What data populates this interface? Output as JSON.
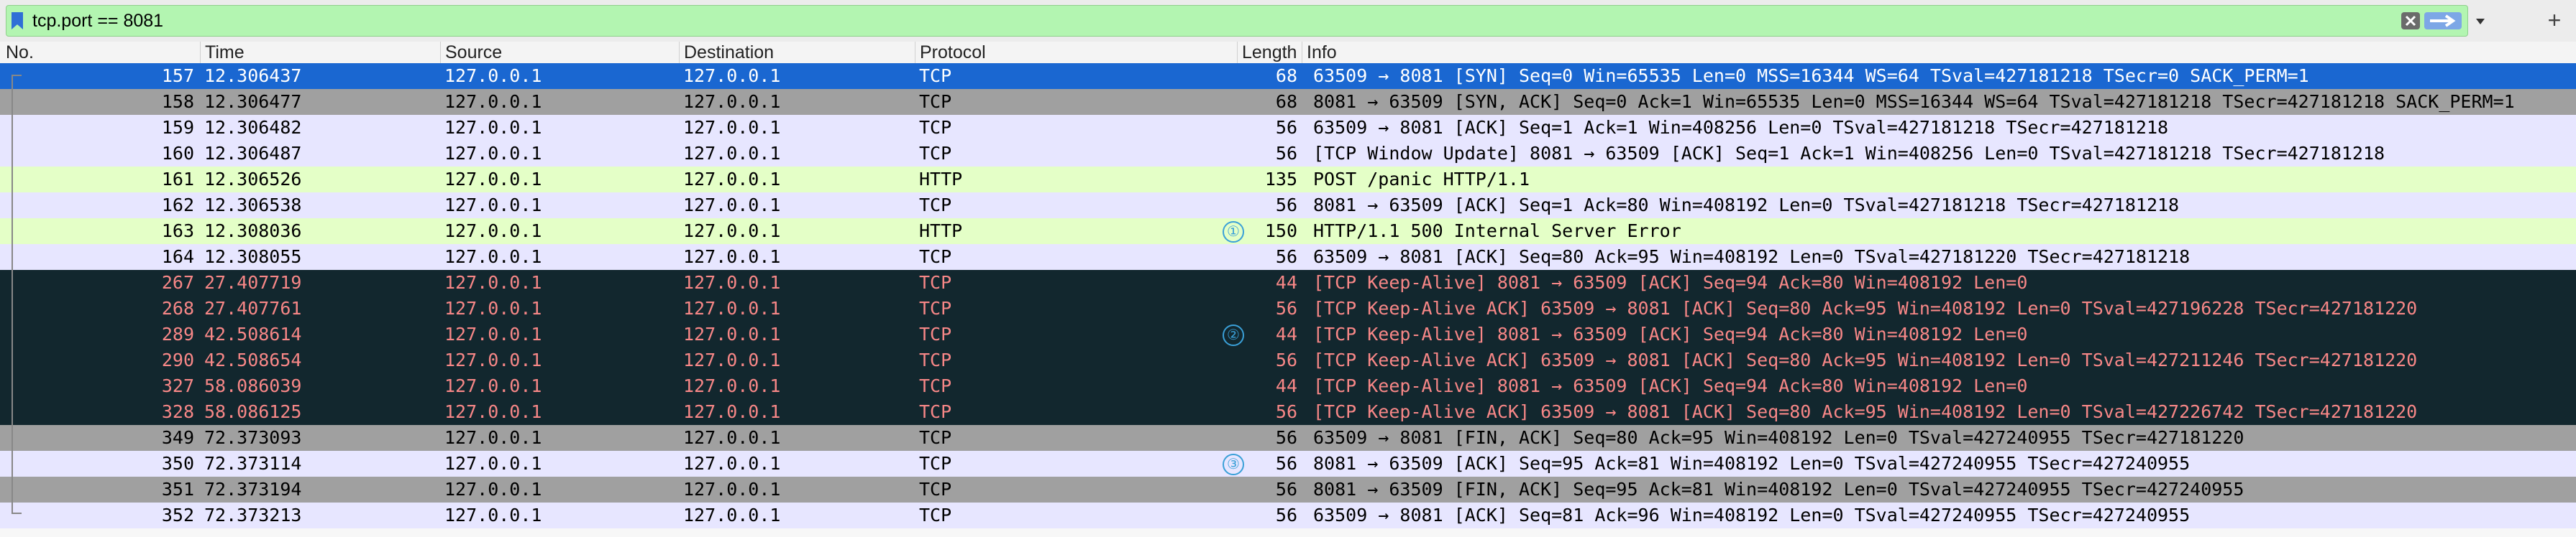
{
  "filter": {
    "value": "tcp.port == 8081",
    "icons": [
      "bookmark-icon",
      "clear-icon",
      "apply-arrow-icon",
      "dropdown-icon",
      "plus-icon"
    ]
  },
  "columns": [
    "No.",
    "Time",
    "Source",
    "Destination",
    "Protocol",
    "Length",
    "Info"
  ],
  "colors": {
    "selected_bg": "#1a67d1",
    "selected_fg": "#ffffff",
    "tcp_bg": "#e7e6ff",
    "http_bg": "#e4ffc7",
    "gray_bg": "#a0a0a0",
    "bad_bg": "#12272e",
    "bad_fg": "#f78787",
    "marker": "#3aa0d8"
  },
  "rows": [
    {
      "no": "157",
      "time": "12.306437",
      "src": "127.0.0.1",
      "dst": "127.0.0.1",
      "proto": "TCP",
      "len": "68",
      "info": "63509 → 8081 [SYN] Seq=0 Win=65535 Len=0 MSS=16344 WS=64 TSval=427181218 TSecr=0 SACK_PERM=1",
      "style": "selected",
      "marker": ""
    },
    {
      "no": "158",
      "time": "12.306477",
      "src": "127.0.0.1",
      "dst": "127.0.0.1",
      "proto": "TCP",
      "len": "68",
      "info": "8081 → 63509 [SYN, ACK] Seq=0 Ack=1 Win=65535 Len=0 MSS=16344 WS=64 TSval=427181218 TSecr=427181218 SACK_PERM=1",
      "style": "gray",
      "marker": ""
    },
    {
      "no": "159",
      "time": "12.306482",
      "src": "127.0.0.1",
      "dst": "127.0.0.1",
      "proto": "TCP",
      "len": "56",
      "info": "63509 → 8081 [ACK] Seq=1 Ack=1 Win=408256 Len=0 TSval=427181218 TSecr=427181218",
      "style": "tcp",
      "marker": ""
    },
    {
      "no": "160",
      "time": "12.306487",
      "src": "127.0.0.1",
      "dst": "127.0.0.1",
      "proto": "TCP",
      "len": "56",
      "info": "[TCP Window Update] 8081 → 63509 [ACK] Seq=1 Ack=1 Win=408256 Len=0 TSval=427181218 TSecr=427181218",
      "style": "tcp",
      "marker": ""
    },
    {
      "no": "161",
      "time": "12.306526",
      "src": "127.0.0.1",
      "dst": "127.0.0.1",
      "proto": "HTTP",
      "len": "135",
      "info": "POST /panic HTTP/1.1",
      "style": "http",
      "marker": ""
    },
    {
      "no": "162",
      "time": "12.306538",
      "src": "127.0.0.1",
      "dst": "127.0.0.1",
      "proto": "TCP",
      "len": "56",
      "info": "8081 → 63509 [ACK] Seq=1 Ack=80 Win=408192 Len=0 TSval=427181218 TSecr=427181218",
      "style": "tcp",
      "marker": ""
    },
    {
      "no": "163",
      "time": "12.308036",
      "src": "127.0.0.1",
      "dst": "127.0.0.1",
      "proto": "HTTP",
      "len": "150",
      "info": "HTTP/1.1 500 Internal Server Error",
      "style": "http",
      "marker": "①"
    },
    {
      "no": "164",
      "time": "12.308055",
      "src": "127.0.0.1",
      "dst": "127.0.0.1",
      "proto": "TCP",
      "len": "56",
      "info": "63509 → 8081 [ACK] Seq=80 Ack=95 Win=408192 Len=0 TSval=427181220 TSecr=427181218",
      "style": "tcp",
      "marker": ""
    },
    {
      "no": "267",
      "time": "27.407719",
      "src": "127.0.0.1",
      "dst": "127.0.0.1",
      "proto": "TCP",
      "len": "44",
      "info": "[TCP Keep-Alive] 8081 → 63509 [ACK] Seq=94 Ack=80 Win=408192 Len=0",
      "style": "bad",
      "marker": ""
    },
    {
      "no": "268",
      "time": "27.407761",
      "src": "127.0.0.1",
      "dst": "127.0.0.1",
      "proto": "TCP",
      "len": "56",
      "info": "[TCP Keep-Alive ACK] 63509 → 8081 [ACK] Seq=80 Ack=95 Win=408192 Len=0 TSval=427196228 TSecr=427181220",
      "style": "bad",
      "marker": ""
    },
    {
      "no": "289",
      "time": "42.508614",
      "src": "127.0.0.1",
      "dst": "127.0.0.1",
      "proto": "TCP",
      "len": "44",
      "info": "[TCP Keep-Alive] 8081 → 63509 [ACK] Seq=94 Ack=80 Win=408192 Len=0",
      "style": "bad",
      "marker": "②"
    },
    {
      "no": "290",
      "time": "42.508654",
      "src": "127.0.0.1",
      "dst": "127.0.0.1",
      "proto": "TCP",
      "len": "56",
      "info": "[TCP Keep-Alive ACK] 63509 → 8081 [ACK] Seq=80 Ack=95 Win=408192 Len=0 TSval=427211246 TSecr=427181220",
      "style": "bad",
      "marker": ""
    },
    {
      "no": "327",
      "time": "58.086039",
      "src": "127.0.0.1",
      "dst": "127.0.0.1",
      "proto": "TCP",
      "len": "44",
      "info": "[TCP Keep-Alive] 8081 → 63509 [ACK] Seq=94 Ack=80 Win=408192 Len=0",
      "style": "bad",
      "marker": ""
    },
    {
      "no": "328",
      "time": "58.086125",
      "src": "127.0.0.1",
      "dst": "127.0.0.1",
      "proto": "TCP",
      "len": "56",
      "info": "[TCP Keep-Alive ACK] 63509 → 8081 [ACK] Seq=80 Ack=95 Win=408192 Len=0 TSval=427226742 TSecr=427181220",
      "style": "bad",
      "marker": ""
    },
    {
      "no": "349",
      "time": "72.373093",
      "src": "127.0.0.1",
      "dst": "127.0.0.1",
      "proto": "TCP",
      "len": "56",
      "info": "63509 → 8081 [FIN, ACK] Seq=80 Ack=95 Win=408192 Len=0 TSval=427240955 TSecr=427181220",
      "style": "gray",
      "marker": ""
    },
    {
      "no": "350",
      "time": "72.373114",
      "src": "127.0.0.1",
      "dst": "127.0.0.1",
      "proto": "TCP",
      "len": "56",
      "info": "8081 → 63509 [ACK] Seq=95 Ack=81 Win=408192 Len=0 TSval=427240955 TSecr=427240955",
      "style": "tcp",
      "marker": "③"
    },
    {
      "no": "351",
      "time": "72.373194",
      "src": "127.0.0.1",
      "dst": "127.0.0.1",
      "proto": "TCP",
      "len": "56",
      "info": "8081 → 63509 [FIN, ACK] Seq=95 Ack=81 Win=408192 Len=0 TSval=427240955 TSecr=427240955",
      "style": "gray",
      "marker": ""
    },
    {
      "no": "352",
      "time": "72.373213",
      "src": "127.0.0.1",
      "dst": "127.0.0.1",
      "proto": "TCP",
      "len": "56",
      "info": "63509 → 8081 [ACK] Seq=81 Ack=96 Win=408192 Len=0 TSval=427240955 TSecr=427240955",
      "style": "tcp",
      "marker": ""
    }
  ]
}
